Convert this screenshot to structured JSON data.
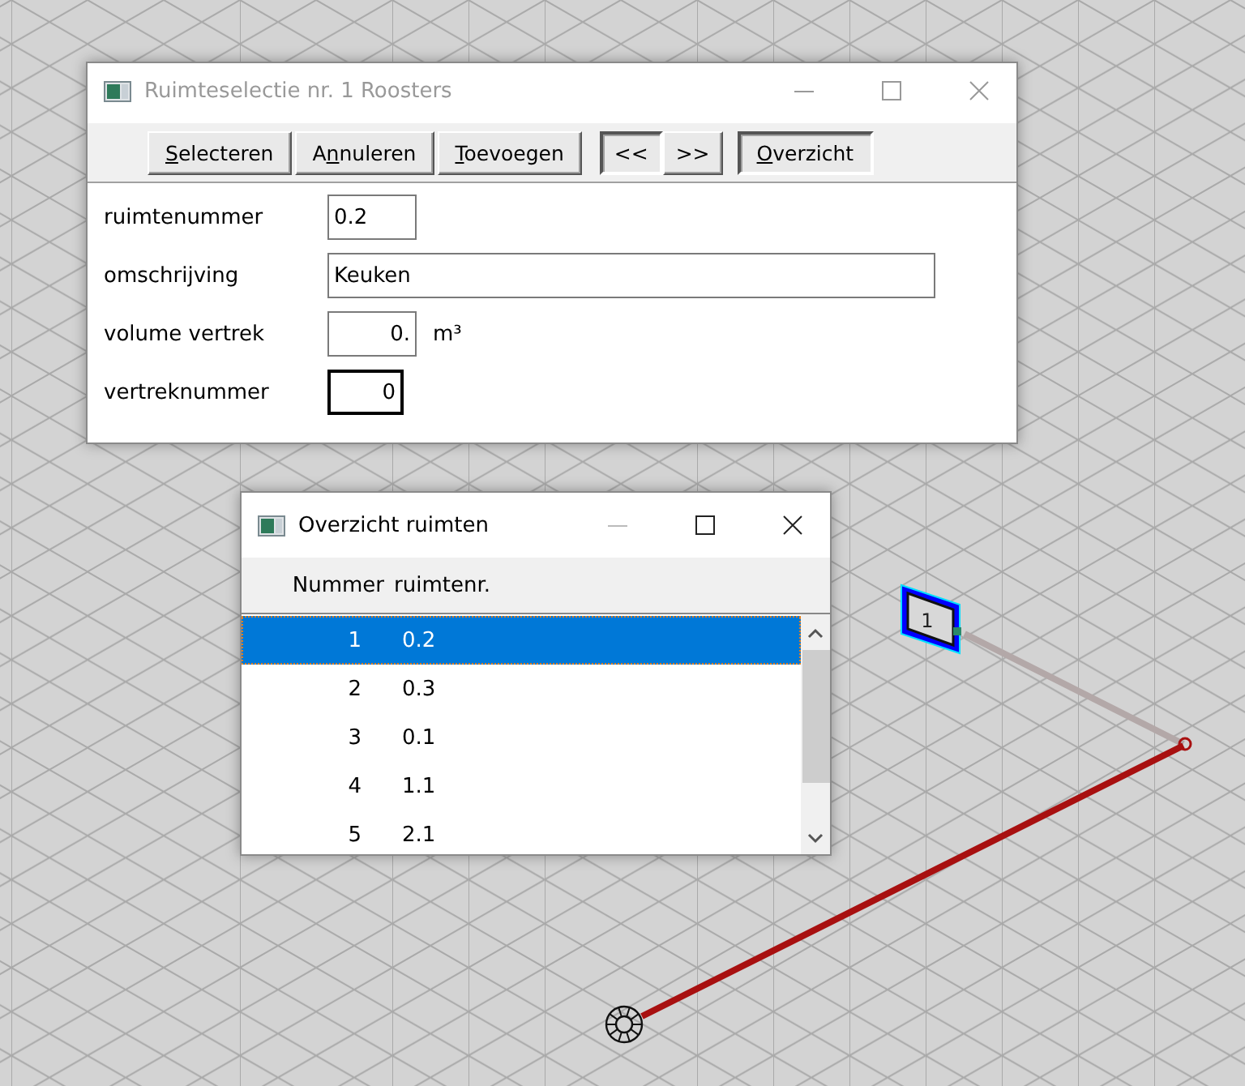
{
  "canvas": {
    "tag": {
      "label": "1"
    }
  },
  "main_window": {
    "title": "Ruimteselectie nr. 1 Roosters",
    "active": false,
    "toolbar": [
      {
        "kind": "action",
        "key": "S",
        "after": "electeren",
        "default": false
      },
      {
        "kind": "action",
        "before": "A",
        "key": "n",
        "after": "nuleren",
        "default": false
      },
      {
        "kind": "action",
        "key": "T",
        "after": "oevoegen",
        "default": false
      },
      {
        "kind": "nav",
        "before": "<<",
        "default": true
      },
      {
        "kind": "nav",
        "before": ">>",
        "default": false
      },
      {
        "kind": "action",
        "key": "O",
        "after": "verzicht",
        "default": true
      }
    ],
    "fields": [
      {
        "kind": "code",
        "label": "ruimtenummer",
        "value": "0.2",
        "focused": false
      },
      {
        "kind": "description",
        "label": "omschrijving",
        "value": "Keuken",
        "focused": false
      },
      {
        "kind": "number",
        "label": "volume vertrek",
        "value": "0.",
        "focused": false,
        "unit": "m³"
      },
      {
        "kind": "number",
        "label": "vertreknummer",
        "value": "0",
        "focused": true
      }
    ]
  },
  "list_window": {
    "title": "Overzicht ruimten",
    "active": true,
    "columns": [
      "Nummer",
      "ruimtenr."
    ],
    "rows": [
      {
        "cells": [
          "1",
          "0.2"
        ],
        "selected": true
      },
      {
        "cells": [
          "2",
          "0.3"
        ],
        "selected": false
      },
      {
        "cells": [
          "3",
          "0.1"
        ],
        "selected": false
      },
      {
        "cells": [
          "4",
          "1.1"
        ],
        "selected": false
      },
      {
        "cells": [
          "5",
          "2.1"
        ],
        "selected": false
      }
    ]
  }
}
